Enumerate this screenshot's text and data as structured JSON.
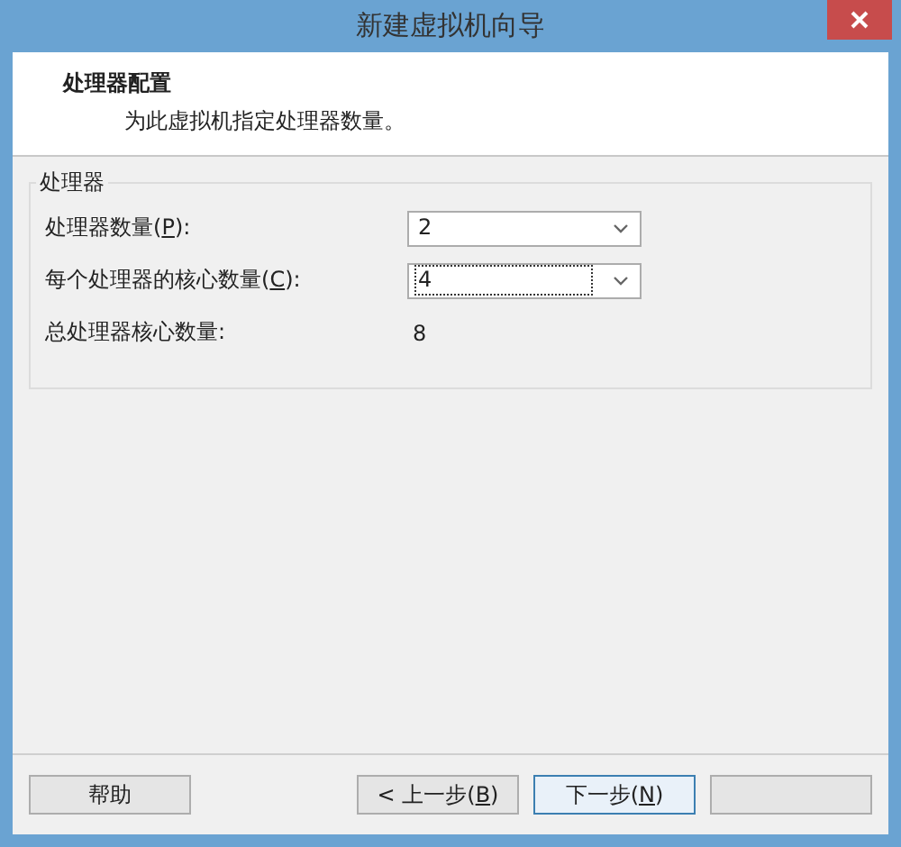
{
  "window": {
    "title": "新建虚拟机向导"
  },
  "header": {
    "title": "处理器配置",
    "subtitle": "为此虚拟机指定处理器数量。"
  },
  "group": {
    "title": "处理器",
    "rows": [
      {
        "kind": "select",
        "label_before": "处理器数量(",
        "accesskey": "P",
        "label_after": "):",
        "value": "2",
        "focused": false
      },
      {
        "kind": "select",
        "label_before": "每个处理器的核心数量(",
        "accesskey": "C",
        "label_after": "):",
        "value": "4",
        "focused": true
      },
      {
        "kind": "readout",
        "label": "总处理器核心数量:",
        "value": "8"
      }
    ]
  },
  "buttons": [
    {
      "label_before": "帮助",
      "selected": false
    },
    {
      "label_before": "< 上一步(",
      "accesskey": "B",
      "label_after": ")",
      "selected": false
    },
    {
      "label_before": "下一步(",
      "accesskey": "N",
      "label_after": ")",
      "selected": true
    },
    {
      "selected": false
    }
  ]
}
